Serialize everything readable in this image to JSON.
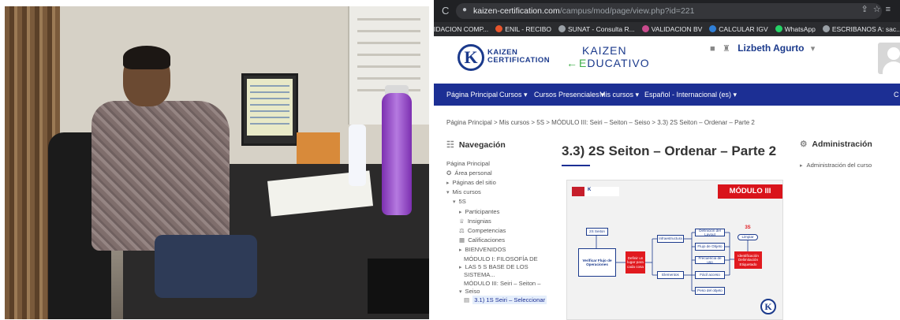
{
  "browser": {
    "url_domain": "kaizen-certification.com",
    "url_path": "/campus/mod/page/view.php?id=221",
    "bookmarks": [
      {
        "label": "IDACION COMP...",
        "color": ""
      },
      {
        "label": "ENIL - RECIBO",
        "color": "#e8542b"
      },
      {
        "label": "SUNAT - Consulta R...",
        "color": "#9aa0a6"
      },
      {
        "label": "VALIDACION BV",
        "color": "#c94b8d"
      },
      {
        "label": "CALCULAR IGV",
        "color": "#2f7fd7"
      },
      {
        "label": "WhatsApp",
        "color": "#25d366"
      },
      {
        "label": "ESCRIBANOS A: sac...",
        "color": "#9aa0a6"
      }
    ]
  },
  "header": {
    "logo1_line1": "KAIZEN",
    "logo1_line2": "CERTIFICATION",
    "logo1_letter": "K",
    "logo2_line1": "KAIZEN",
    "logo2_line2": "DUCATIVO",
    "user_name": "Lizbeth Agurto"
  },
  "navbar": {
    "items": [
      "Página Principal",
      "Cursos ▾",
      "Cursos Presenciales ▾",
      "Mis cursos ▾",
      "Español - Internacional (es) ▾",
      "C"
    ]
  },
  "breadcrumb": "Página Principal  >  Mis cursos  >  5S  >  MÓDULO III: Seiri – Seiton – Seiso  >  3.3) 2S Seiton – Ordenar – Parte 2",
  "left_block": {
    "title": "Navegación",
    "items": [
      {
        "label": "Página Principal",
        "arrow": ""
      },
      {
        "label": "Área personal",
        "arrow": "",
        "icon": "✪"
      },
      {
        "label": "Páginas del sitio",
        "arrow": "▸"
      },
      {
        "label": "Mis cursos",
        "arrow": "▾"
      },
      {
        "label": "5S",
        "arrow": "▾"
      },
      {
        "label": "Participantes",
        "arrow": "▸"
      },
      {
        "label": "Insignias",
        "arrow": "",
        "icon": "♕"
      },
      {
        "label": "Competencias",
        "arrow": "",
        "icon": "⚖"
      },
      {
        "label": "Calificaciones",
        "arrow": "",
        "icon": "▦"
      },
      {
        "label": "BIENVENIDOS",
        "arrow": "▸"
      },
      {
        "label": "MÓDULO I: FILOSOFÍA DE",
        "arrow": ""
      },
      {
        "label": "LAS 5 S BASE DE LOS",
        "arrow": "▸"
      },
      {
        "label": "SISTEMA...",
        "arrow": ""
      },
      {
        "label": "MÓDULO III: Seiri – Seiton –",
        "arrow": ""
      },
      {
        "label": "Seiso",
        "arrow": "▾"
      },
      {
        "label": "3.1) 1S Seiri – Seleccionar",
        "arrow": "",
        "icon": "▤"
      }
    ]
  },
  "main": {
    "title": "3.3) 2S Seiton – Ordenar – Parte 2",
    "slide": {
      "badge": "MÓDULO III",
      "brand": "K",
      "boxes": {
        "seiton": "2S Seiton",
        "verificar": "Verificar Flujo de Operaciones",
        "definir": "Definir un lugar para cada cosa",
        "infra": "Infraestructura",
        "elementos": "Elementos",
        "def_layout": "Definición del Layout",
        "flujo": "Flujo de Objeto",
        "frecuencia": "Frecuencia de uso",
        "facil": "Fácil acceso",
        "peso": "Peso del objeto",
        "limpiar": "Limpiar",
        "ident": "Identificación Delimitación Etiquetado",
        "s3": "3S"
      }
    }
  },
  "right_block": {
    "title": "Administración",
    "item": "Administración del curso"
  }
}
